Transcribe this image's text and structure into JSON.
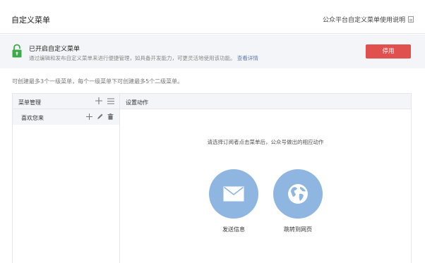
{
  "header": {
    "title": "自定义菜单",
    "help_link": "公众平台自定义菜单使用说明"
  },
  "banner": {
    "title": "已开启自定义菜单",
    "description": "通过编辑和发布自定义菜单来进行便捷管理，如具备开发能力，可更灵活地使用该功能。",
    "detail_link": "查看详情",
    "disable_button": "停用"
  },
  "limit_text": "可创建最多3个一级菜单，每个一级菜单下可创建最多5个二级菜单。",
  "menu_panel": {
    "header": "菜单管理",
    "items": [
      {
        "label": "喜欢您来"
      }
    ]
  },
  "action_panel": {
    "header": "设置动作",
    "prompt": "请选择订阅者点击菜单后，公众号做出的相应动作",
    "actions": [
      {
        "label": "发送信息",
        "icon": "envelope-icon"
      },
      {
        "label": "跳转到网页",
        "icon": "globe-icon"
      }
    ]
  },
  "colors": {
    "danger": "#e0504e",
    "action_circle": "#8fb6e0",
    "link": "#5a7ab8",
    "lock_green": "#3eaa4a"
  }
}
